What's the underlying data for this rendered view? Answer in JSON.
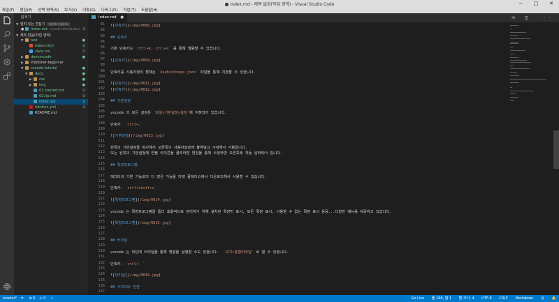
{
  "window": {
    "title": "index.md - 제목 없음(작업 영역) - Visual Studio Code",
    "controls": [
      "─",
      "□",
      "✕"
    ]
  },
  "menu": [
    "파일(F)",
    "편집(E)",
    "선택 영역(S)",
    "보기(V)",
    "이동(G)",
    "디버그(D)",
    "작업(T)",
    "도움말(H)"
  ],
  "sidebar": {
    "header": "탐색기",
    "open_editors": {
      "label": "열려 있는 편집기",
      "badge": "저장하지 않음(1)",
      "file": "index.md",
      "path": "vscode-tutorial/docs",
      "status": "U"
    },
    "workspace_label": "제목 없음(작업 영역)",
    "tree": [
      {
        "label": "test",
        "depth": 1,
        "kind": "folder-open",
        "status": "●"
      },
      {
        "label": "index.html",
        "depth": 2,
        "kind": "html",
        "status": "U"
      },
      {
        "label": "style.css",
        "depth": 2,
        "kind": "css",
        "status": "U"
      },
      {
        "label": "demuncode",
        "depth": 1,
        "kind": "folder",
        "status": "●"
      },
      {
        "label": "Publisher-beginner",
        "depth": 1,
        "kind": "folder",
        "status": ""
      },
      {
        "label": "vscode-tutorial",
        "depth": 1,
        "kind": "folder-open",
        "status": "●"
      },
      {
        "label": "docs",
        "depth": 2,
        "kind": "folder-open",
        "status": "●"
      },
      {
        "label": "css",
        "depth": 3,
        "kind": "folder",
        "status": "●"
      },
      {
        "label": "img",
        "depth": 3,
        "kind": "folder",
        "status": "●"
      },
      {
        "label": "01.started.md",
        "depth": 3,
        "kind": "md",
        "status": "U"
      },
      {
        "label": "02.tip.md",
        "depth": 3,
        "kind": "md",
        "status": "U"
      },
      {
        "label": "index.md",
        "depth": 3,
        "kind": "md",
        "status": "U",
        "selected": true
      },
      {
        "label": "mkdocs.yml",
        "depth": 2,
        "kind": "yml",
        "status": "U"
      },
      {
        "label": "README.md",
        "depth": 2,
        "kind": "info",
        "status": ""
      }
    ]
  },
  "tabs": [
    {
      "label": "index.md",
      "close": "●"
    }
  ],
  "tab_tools": "⇲ ◫ ···",
  "editor": {
    "lines": [
      {
        "n": "91",
        "text": "![단축키](/img/0008.jpg)"
      },
      {
        "n": "92",
        "text": ""
      },
      {
        "n": "93",
        "text": "## 단축키"
      },
      {
        "n": "94",
        "text": ""
      },
      {
        "n": "95",
        "text": "기본 단축키는 `ctrl+k, ctrl+s` 를 통해 열람할 수 있습니다."
      },
      {
        "n": "96",
        "text": ""
      },
      {
        "n": "97",
        "text": "![단축키](/img/0009.jpg)"
      },
      {
        "n": "98",
        "text": ""
      },
      {
        "n": "99",
        "text": "단축키를 사용자정의 할때는 `keybindings.json` 파일을 통해 지정할 수 있습니다."
      },
      {
        "n": "100",
        "text": ""
      },
      {
        "n": "101",
        "text": "![단축키](/img/0011.jpg)"
      },
      {
        "n": "102",
        "text": "![단축키](/img/0012.jpg)"
      },
      {
        "n": "103",
        "text": ""
      },
      {
        "n": "104",
        "text": "## 기본설정"
      },
      {
        "n": "105",
        "text": ""
      },
      {
        "n": "106",
        "text": "vscode 의 모든 설정은 `파일>기본설정>설정`에 지정되어 있습니다."
      },
      {
        "n": "107",
        "text": ""
      },
      {
        "n": "108",
        "text": "단축키: `ctrl+,`"
      },
      {
        "n": "109",
        "text": ""
      },
      {
        "n": "110",
        "text": "![기본설정](/img/0013.jpg)"
      },
      {
        "n": "111",
        "text": ""
      },
      {
        "n": "112",
        "text": "왼쪽의 기본설정을 복사해서 오른쪽의 사용자설정에 붙여넣고 수정해서 사용합니다."
      },
      {
        "n": "113",
        "text": "또는 왼쪽의 기본설정에 연필 아이콘을 클릭하면 편집을 통해 수정하면 오른쪽에 자동 입력되어 집니다."
      },
      {
        "n": "114",
        "text": ""
      },
      {
        "n": "115",
        "text": "## 확장프로그램"
      },
      {
        "n": "116",
        "text": ""
      },
      {
        "n": "117",
        "text": "에디터의 기본 기능보다 더 많은 기능을 마켓 플레이스에서 다운로드해서 사용할 수 있습니다."
      },
      {
        "n": "118",
        "text": ""
      },
      {
        "n": "119",
        "text": "단축키: `ctrl+shift+x`"
      },
      {
        "n": "120",
        "text": ""
      },
      {
        "n": "121",
        "text": "![확장프로그램](/img/0014.jpg)"
      },
      {
        "n": "122",
        "text": ""
      },
      {
        "n": "123",
        "text": "vscode 는 확장프로그램을 좀더 효율적으로 관리하기 위해 설치된 확장만 표시, 모든 확장 표시, 사용할 수 없는 확장 표시 등등...다양한 메뉴를 제공하고 있습니다."
      },
      {
        "n": "124",
        "text": ""
      },
      {
        "n": "125",
        "text": "![확장프로그램](/img/0015.jpg)"
      },
      {
        "n": "126",
        "text": ""
      },
      {
        "n": "127",
        "text": ""
      },
      {
        "n": "128",
        "text": "## 터미널"
      },
      {
        "n": "129",
        "text": ""
      },
      {
        "n": "130",
        "text": "vscode 는 하단에 터미널을 통해 명령을 실행할 수도 있습니다.  `보기>통합터미널` 로 열 수 있습니다."
      },
      {
        "n": "131",
        "text": ""
      },
      {
        "n": "132",
        "text": "단축키: `ctrl+` `"
      },
      {
        "n": "133",
        "text": ""
      },
      {
        "n": "134",
        "text": "![터미널](/img/0016.jpg)"
      },
      {
        "n": "135",
        "text": ""
      },
      {
        "n": "136",
        "text": "## 사이드바 전환"
      },
      {
        "n": "137",
        "text": ""
      }
    ]
  },
  "statusbar": {
    "left": [
      "master*",
      "⟳",
      "⊗ 0",
      "⚠ 0",
      "⚡"
    ],
    "right": [
      "Go Live",
      "줄 166, 열 1",
      "탭 크기: 4",
      "UTF-8",
      "CRLF",
      "Markdown",
      "☺",
      "🔔"
    ]
  },
  "colors": {
    "accent": "#007acc",
    "editor_bg": "#1e1e1e",
    "sidebar_bg": "#252526",
    "activity_bg": "#333333"
  }
}
